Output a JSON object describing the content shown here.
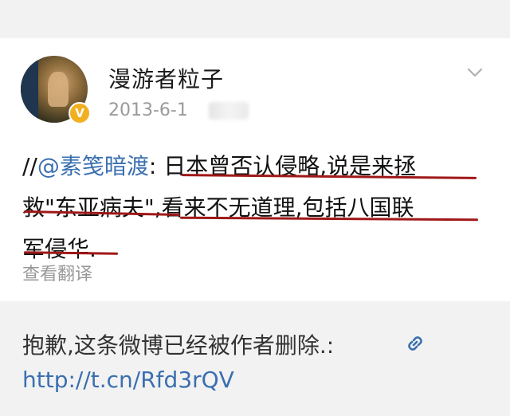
{
  "post": {
    "username": "漫游者粒子",
    "timestamp": "2013-6-1",
    "verify_badge": "V",
    "text": {
      "prefix": "//",
      "mention": "@素笺暗渡",
      "line1_rest": ": 日本曾否认侵略,说是来拯",
      "line2": "救\"东亚病夫\",看来不无道理,包括八国联",
      "line3": "军侵华."
    },
    "translate_label": "查看翻译",
    "underline_color": "#a01818"
  },
  "repost": {
    "deleted_notice": "抱歉,这条微博已经被作者删除.:",
    "link_icon": "link-icon",
    "short_url": "http://t.cn/Rfd3rQV"
  },
  "colors": {
    "link": "#3a6fb0",
    "muted": "#999999",
    "background_gray": "#f2f2f2"
  }
}
